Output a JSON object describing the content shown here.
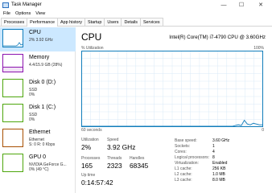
{
  "window": {
    "title": "Task Manager",
    "minimize": "—",
    "maximize": "☐",
    "close": "✕"
  },
  "menu": [
    "File",
    "Options",
    "View"
  ],
  "tabs": [
    "Processes",
    "Performance",
    "App history",
    "Startup",
    "Users",
    "Details",
    "Services"
  ],
  "active_tab": "Performance",
  "sidebar": [
    {
      "name": "CPU",
      "sub1": "2%  3.92 GHz",
      "color": "#117dbb",
      "active": true
    },
    {
      "name": "Memory",
      "sub1": "4.4/15.9 GB (28%)",
      "color": "#8b12ae"
    },
    {
      "name": "Disk 0 (D:)",
      "sub1": "SSD",
      "sub2": "0%",
      "color": "#4da60c"
    },
    {
      "name": "Disk 1 (C:)",
      "sub1": "SSD",
      "sub2": "0%",
      "color": "#4da60c"
    },
    {
      "name": "Ethernet",
      "sub1": "Ethernet",
      "sub2": "S: 0  R: 0 Kbps",
      "color": "#a74f01"
    },
    {
      "name": "GPU 0",
      "sub1": "NVIDIA GeForce G...",
      "sub2": "0% (49 °C)",
      "color": "#4da60c"
    }
  ],
  "main": {
    "title": "CPU",
    "model": "Intel(R) Core(TM) i7-4790 CPU @ 3.60GHz",
    "graph_label": "% Utilization",
    "graph_max": "100%",
    "graph_time": "60 seconds",
    "graph_min": "0",
    "graph_color": "#117dbb",
    "utilization_series": [
      0,
      0,
      0,
      0,
      0,
      0,
      0,
      0,
      0,
      0,
      0,
      0,
      0,
      0,
      0,
      0,
      0,
      0,
      0,
      0,
      0,
      0,
      0,
      0,
      0,
      0,
      0,
      0,
      0,
      0,
      0,
      0,
      0,
      0,
      0,
      0,
      0,
      0,
      0,
      0,
      0,
      0,
      0,
      0,
      0,
      0,
      0,
      0,
      0,
      0,
      0,
      1,
      2,
      1,
      8,
      3,
      2,
      4,
      3,
      2,
      2
    ]
  },
  "stats": {
    "utilization_label": "Utilization",
    "utilization": "2%",
    "speed_label": "Speed",
    "speed": "3.92 GHz",
    "processes_label": "Processes",
    "processes": "165",
    "threads_label": "Threads",
    "threads": "2323",
    "handles_label": "Handles",
    "handles": "68345",
    "uptime_label": "Up time",
    "uptime": "0:14:57:42"
  },
  "specs": [
    {
      "label": "Base speed:",
      "value": "3.60 GHz"
    },
    {
      "label": "Sockets:",
      "value": "1"
    },
    {
      "label": "Cores:",
      "value": "4"
    },
    {
      "label": "Logical processors:",
      "value": "8"
    },
    {
      "label": "Virtualization:",
      "value": "Enabled"
    },
    {
      "label": "L1 cache:",
      "value": "256 KB"
    },
    {
      "label": "L2 cache:",
      "value": "1.0 MB"
    },
    {
      "label": "L3 cache:",
      "value": "8.0 MB"
    }
  ]
}
